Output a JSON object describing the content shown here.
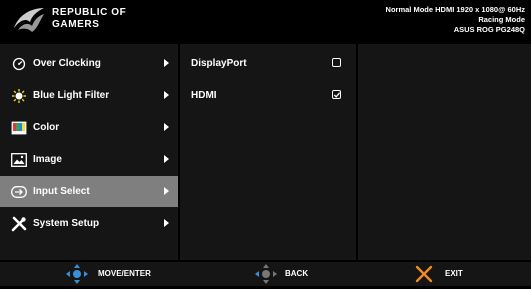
{
  "header": {
    "brand_line1": "REPUBLIC OF",
    "brand_line2": "GAMERS",
    "status_line1": "Normal Mode HDMI 1920 x 1080@ 60Hz",
    "status_line2": "Racing Mode",
    "status_line3": "ASUS ROG PG248Q"
  },
  "main_menu": {
    "items": [
      {
        "label": "Over Clocking",
        "icon": "speedometer-icon"
      },
      {
        "label": "Blue Light Filter",
        "icon": "light-bulb-icon"
      },
      {
        "label": "Color",
        "icon": "color-palette-icon"
      },
      {
        "label": "Image",
        "icon": "image-icon"
      },
      {
        "label": "Input Select",
        "icon": "input-select-icon",
        "selected": true
      },
      {
        "label": "System Setup",
        "icon": "tools-icon"
      }
    ]
  },
  "submenu": {
    "items": [
      {
        "label": "DisplayPort",
        "checked": false
      },
      {
        "label": "HDMI",
        "checked": true
      }
    ]
  },
  "footer": {
    "move_label": "MOVE/ENTER",
    "back_label": "BACK",
    "exit_label": "EXIT"
  },
  "colors": {
    "background": "#000000",
    "panel": "#151515",
    "selected": "#7f7f7f",
    "joystick_blue": "#3a8fd8",
    "exit_orange": "#f08a24"
  }
}
